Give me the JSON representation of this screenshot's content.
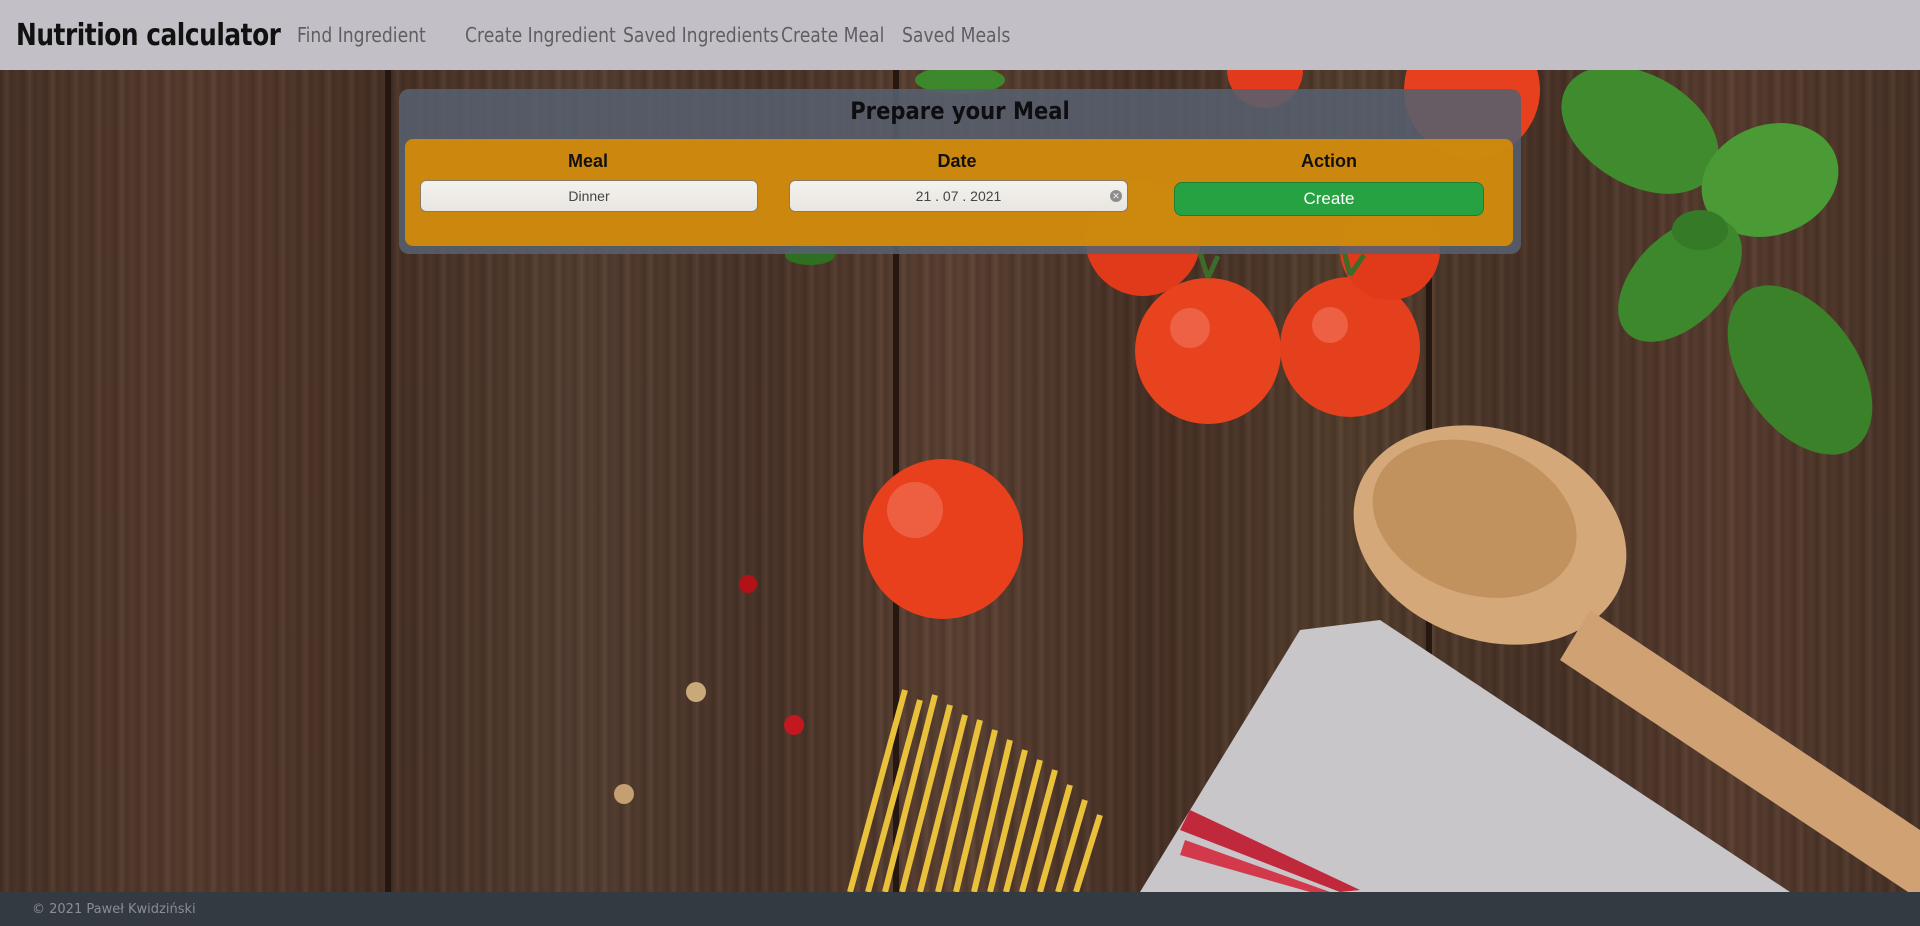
{
  "navbar": {
    "brand": "Nutrition calculator",
    "links": [
      "Find Ingredient",
      "Create Ingredient",
      "Saved Ingredients",
      "Create Meal",
      "Saved Meals"
    ]
  },
  "panel": {
    "title": "Prepare your Meal",
    "columns": {
      "meal": "Meal",
      "date": "Date",
      "action": "Action"
    },
    "meal_value": "Dinner",
    "date_value": "21 . 07 . 2021",
    "create_label": "Create"
  },
  "footer": {
    "text": "© 2021 Paweł Kwidziński"
  },
  "colors": {
    "navbar": "#c2c0c6",
    "panel": "#56606e",
    "panel_inner": "#d58c08",
    "create_button": "#27a243",
    "footer": "#343a41"
  }
}
